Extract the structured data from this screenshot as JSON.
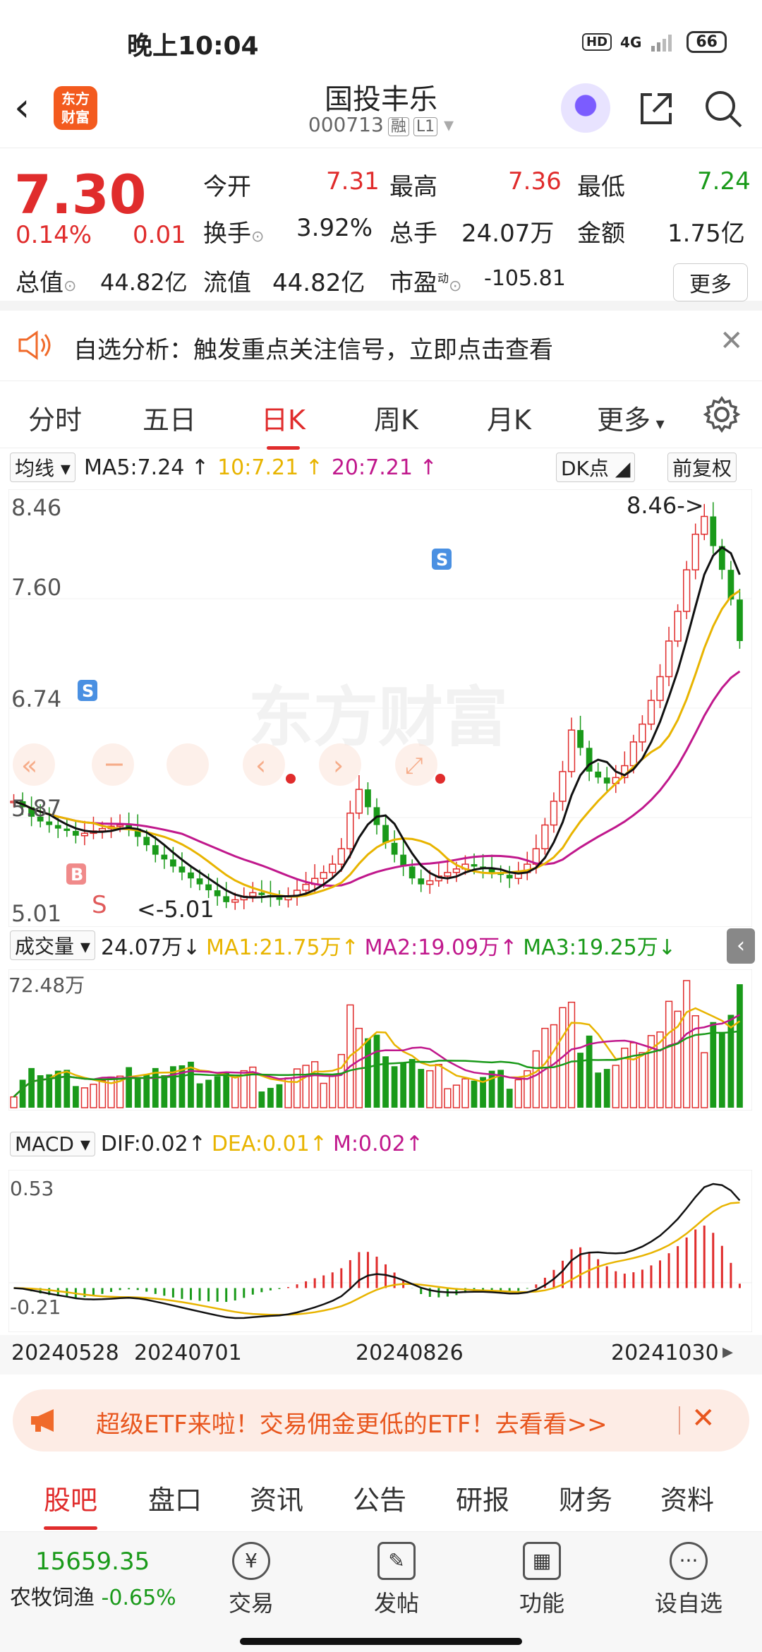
{
  "status": {
    "time": "晚上10:04",
    "network": "4G",
    "hd": "HD",
    "battery": "66"
  },
  "header": {
    "title": "国投丰乐",
    "code": "000713",
    "tag1": "融",
    "tag2": "L1",
    "logo_l1": "东方",
    "logo_l2": "财富"
  },
  "quote": {
    "price": "7.30",
    "change_pct": "0.14%",
    "change": "0.01",
    "open_label": "今开",
    "open": "7.31",
    "high_label": "最高",
    "high": "7.36",
    "low_label": "最低",
    "low": "7.24",
    "turnover_label": "换手",
    "turnover": "3.92%",
    "volume_label": "总手",
    "volume": "24.07万",
    "amount_label": "金额",
    "amount": "1.75亿",
    "mktcap_label": "总值",
    "mktcap": "44.82亿",
    "float_label": "流值",
    "float": "44.82亿",
    "pe_label": "市盈",
    "pe_sup": "动",
    "pe": "-105.81",
    "more": "更多"
  },
  "alert": {
    "text": "自选分析：触发重点关注信号，立即点击查看"
  },
  "period_tabs": [
    "分时",
    "五日",
    "日K",
    "周K",
    "月K",
    "更多"
  ],
  "kline": {
    "ma_select": "均线",
    "ma5": "MA5:7.24",
    "ma10": "10:7.21",
    "ma20": "20:7.21",
    "dk": "DK点",
    "fq": "前复权",
    "y_labels": [
      "8.46",
      "7.60",
      "6.74",
      "5.87",
      "5.01"
    ],
    "max_label": "8.46->",
    "min_label": "<-5.01",
    "watermark": "东方财富",
    "s_marker": "S",
    "b_marker": "B"
  },
  "volume": {
    "select": "成交量",
    "value": "24.07万",
    "ma1": "MA1:21.75万",
    "ma2": "MA2:19.09万",
    "ma3": "MA3:19.25万",
    "max": "72.48万"
  },
  "macd": {
    "select": "MACD",
    "dif": "DIF:0.02",
    "dea": "DEA:0.01",
    "m": "M:0.02",
    "top": "0.53",
    "bottom": "-0.21"
  },
  "dates": [
    "20240528",
    "20240701",
    "20240826",
    "20241030"
  ],
  "banner": {
    "text": "超级ETF来啦！交易佣金更低的ETF！去看看>>"
  },
  "footer_tabs": [
    "股吧",
    "盘口",
    "资讯",
    "公告",
    "研报",
    "财务",
    "资料"
  ],
  "bottom_bar": {
    "index_value": "15659.35",
    "index_name": "农牧饲渔",
    "index_change": "-0.65%",
    "items": [
      "交易",
      "发帖",
      "功能",
      "设自选"
    ]
  },
  "colors": {
    "up": "#e02c2c",
    "down": "#1a9a1a",
    "ma5": "#111111",
    "ma10": "#e8b400",
    "ma20": "#c0188c"
  },
  "chart_data": {
    "type": "candlestick",
    "price_axis": [
      5.01,
      8.46
    ],
    "closes": [
      5.95,
      5.9,
      5.82,
      5.78,
      5.75,
      5.72,
      5.7,
      5.66,
      5.68,
      5.7,
      5.72,
      5.74,
      5.75,
      5.72,
      5.65,
      5.58,
      5.5,
      5.46,
      5.4,
      5.35,
      5.3,
      5.25,
      5.2,
      5.15,
      5.1,
      5.12,
      5.15,
      5.18,
      5.16,
      5.14,
      5.12,
      5.15,
      5.2,
      5.25,
      5.3,
      5.35,
      5.42,
      5.55,
      5.85,
      6.05,
      5.9,
      5.75,
      5.6,
      5.5,
      5.4,
      5.3,
      5.25,
      5.28,
      5.32,
      5.35,
      5.38,
      5.42,
      5.4,
      5.38,
      5.35,
      5.33,
      5.3,
      5.35,
      5.42,
      5.55,
      5.75,
      5.95,
      6.2,
      6.55,
      6.4,
      6.2,
      6.15,
      6.1,
      6.15,
      6.25,
      6.45,
      6.6,
      6.8,
      7.0,
      7.3,
      7.55,
      7.9,
      8.2,
      8.35,
      8.1,
      7.9,
      7.65,
      7.3
    ]
  }
}
